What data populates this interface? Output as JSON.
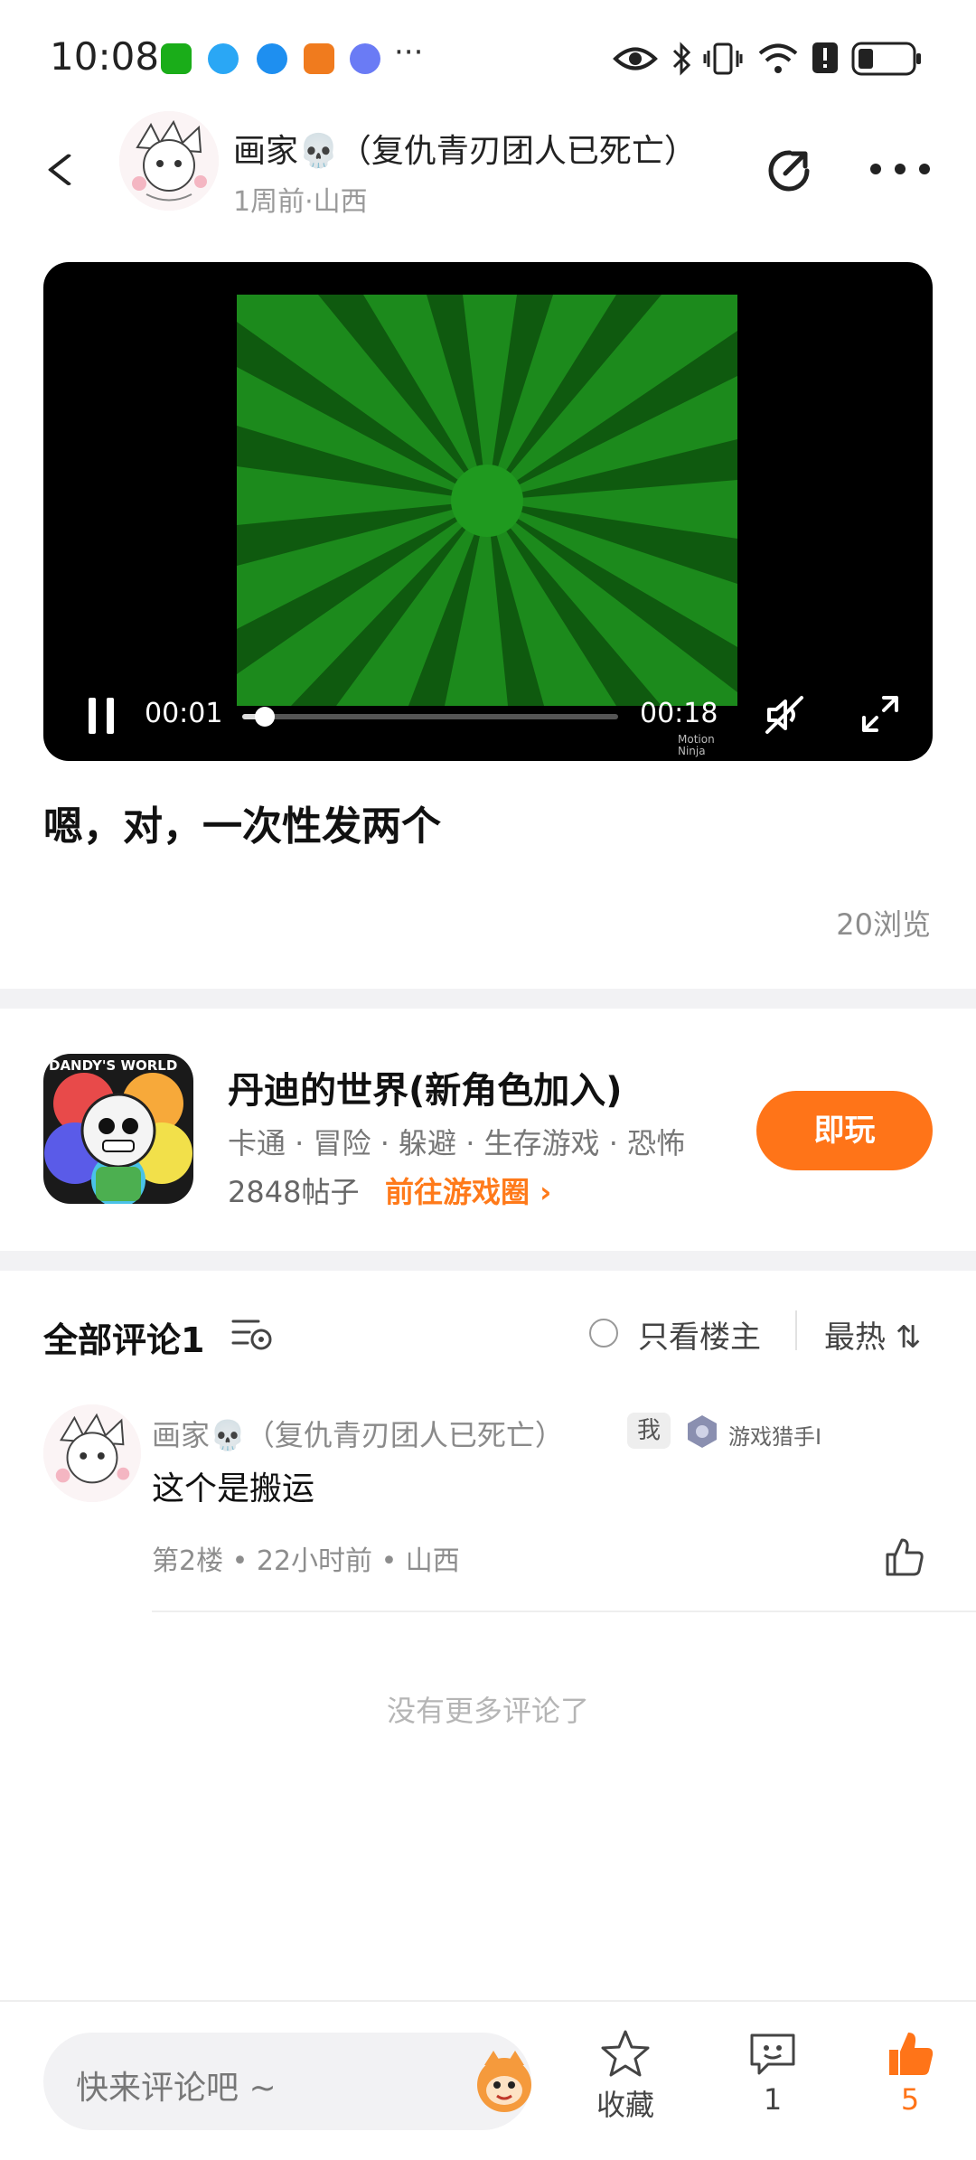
{
  "status_bar": {
    "time": "10:08",
    "overflow": "···",
    "app_icons": [
      {
        "name": "wechat-icon",
        "color": "#1aad19"
      },
      {
        "name": "browser-icon",
        "color": "#2aa7f5"
      },
      {
        "name": "browser-icon",
        "color": "#1e8ff0"
      },
      {
        "name": "app-icon",
        "color": "#f07b1e"
      },
      {
        "name": "music-icon",
        "color": "#6a7bf5"
      }
    ]
  },
  "header": {
    "title": "画家💀（复仇青刃团人已死亡）",
    "meta": "1周前·山西"
  },
  "video": {
    "current_time": "00:01",
    "duration": "00:18",
    "progress": 0.06,
    "watermark_line1": "Motion",
    "watermark_line2": "Ninja"
  },
  "post": {
    "text": "嗯，对，一次性发两个",
    "views": "20浏览"
  },
  "game": {
    "icon_text": "DANDY'S WORLD",
    "title": "丹迪的世界(新角色加入)",
    "tags": "卡通 · 冒险 · 躲避 · 生存游戏 · 恐怖",
    "posts": "2848帖子",
    "link": "前往游戏圈 ›",
    "play_label": "即玩"
  },
  "comments": {
    "title": "全部评论1",
    "only_op": "只看楼主",
    "sort": "最热 ⇅",
    "items": [
      {
        "name": "画家💀（复仇青刃团人已死亡）",
        "badge": "我",
        "title_badge": "游戏猎手I",
        "text": "这个是搬运",
        "meta": "第2楼 • 22小时前 • 山西"
      }
    ],
    "no_more": "没有更多评论了"
  },
  "bottom_bar": {
    "placeholder": "快来评论吧 ~",
    "favorite_label": "收藏",
    "comment_count": "1",
    "like_count": "5"
  },
  "colors": {
    "accent": "#ff7418",
    "video_green": "#1f9a1f"
  }
}
